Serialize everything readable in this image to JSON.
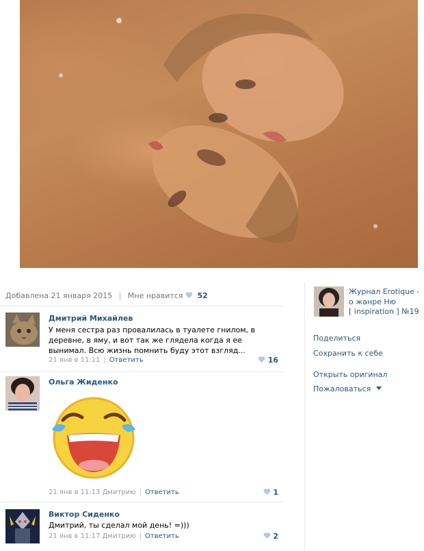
{
  "photo": {
    "icon": "photo-two-faces-image"
  },
  "meta": {
    "added": "Добавлена 21 января 2015",
    "like_label": "Мне нравится",
    "like_count": "52"
  },
  "comments": [
    {
      "author": "Дмитрий Михайлев",
      "text": "У меня сестра раз провалилась в туалете гнилом, в деревне, в яму, и вот так же глядела когда я ее вынимал. Всю жизнь помнить буду этот взгляд...",
      "date": "21 янв в 11:11",
      "reply_label": "Ответить",
      "likes": "16"
    },
    {
      "author": "Ольга Жиденко",
      "sticker": "laughing-crying-emoji",
      "date": "21 янв в 11:13",
      "reply_to": "Дмитрию",
      "reply_label": "Ответить",
      "likes": "1"
    },
    {
      "author": "Виктор Сиденко",
      "text": "Дмитрий, ты сделал мой день! =)))",
      "date": "21 янв в 11:17",
      "reply_to": "Дмитрию",
      "reply_label": "Ответить",
      "likes": "2"
    }
  ],
  "sidebar": {
    "title": "Журнал Erotique - о жанре Ню",
    "subtitle": "[ inspiration ] №19",
    "actions": {
      "share": "Поделиться",
      "save": "Сохранить к себе",
      "open_original": "Открыть оригинал",
      "report": "Пожаловаться"
    }
  },
  "colors": {
    "link": "#2b587a",
    "heart": "#b8c8d8",
    "divider": "#e4e8ed"
  }
}
